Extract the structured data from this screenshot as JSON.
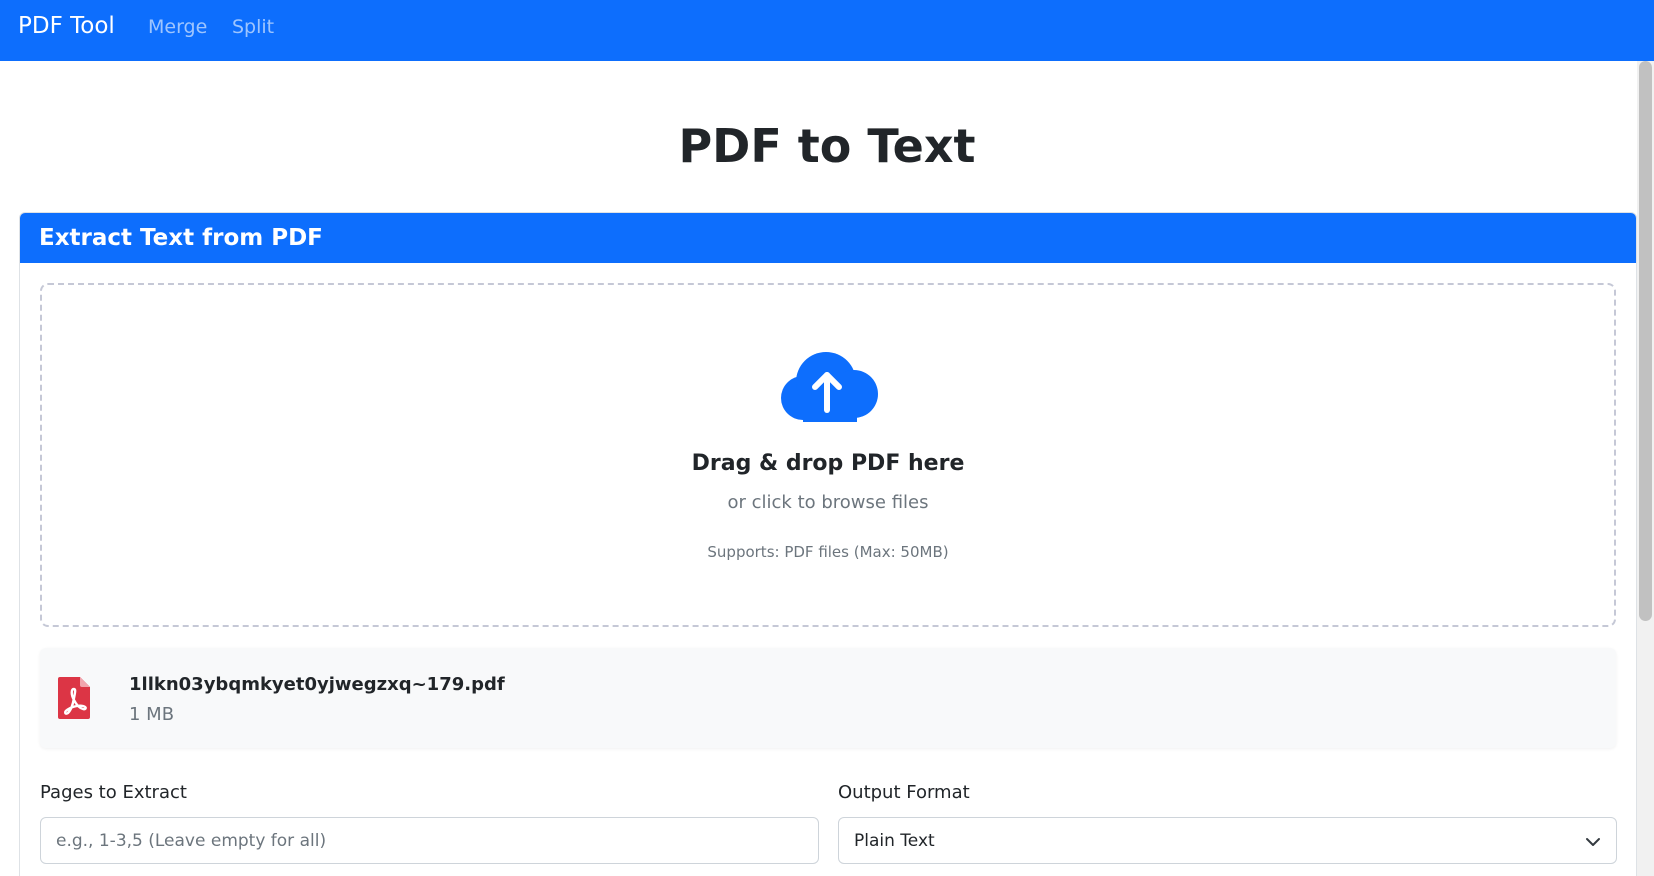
{
  "navbar": {
    "brand": "PDF Tool",
    "links": [
      "Merge",
      "Split"
    ]
  },
  "page": {
    "title": "PDF to Text"
  },
  "card": {
    "title": "Extract Text from PDF"
  },
  "dropzone": {
    "icon": "cloud-upload-icon",
    "title": "Drag & drop PDF here",
    "subtitle": "or click to browse files",
    "note": "Supports: PDF files (Max: 50MB)"
  },
  "file": {
    "icon": "file-pdf-icon",
    "name": "1llkn03ybqmkyet0yjwegzxq~179.pdf",
    "size": "1 MB"
  },
  "options": {
    "pages_label": "Pages to Extract",
    "pages_placeholder": "e.g., 1-3,5 (Leave empty for all)",
    "pages_value": "",
    "format_label": "Output Format",
    "format_value": "Plain Text"
  },
  "colors": {
    "primary": "#0d6efd",
    "pdf_red": "#dc3545",
    "muted": "#6c757d"
  }
}
